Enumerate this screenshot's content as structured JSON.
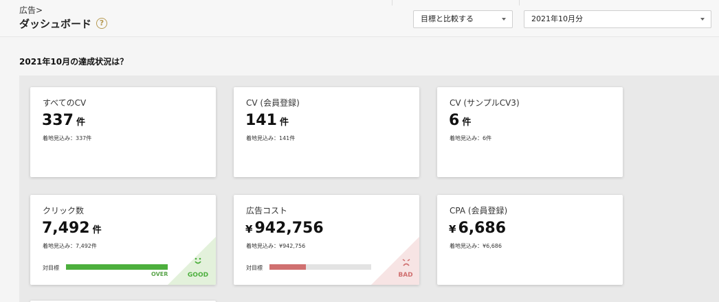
{
  "header": {
    "breadcrumb": "広告>",
    "title": "ダッシュボード",
    "help_icon": "question-circle-icon",
    "compare_select": "目標と比較する",
    "month_select": "2021年10月分"
  },
  "section": {
    "title": "2021年10月の達成状況は？"
  },
  "colors": {
    "good": "#4caf3d",
    "good_corner": "#e3f1db",
    "bad": "#d07070",
    "bad_corner": "#f7e4e4",
    "help": "#b79a52"
  },
  "cards": [
    {
      "label": "すべてのCV",
      "value": "337",
      "unit": "件",
      "forecast": "着地見込み：337件"
    },
    {
      "label": "CV (会員登録)",
      "value": "141",
      "unit": "件",
      "forecast": "着地見込み：141件"
    },
    {
      "label": "CV (サンプルCV3)",
      "value": "6",
      "unit": "件",
      "forecast": "着地見込み：6件"
    },
    {
      "label": "クリック数",
      "value": "7,492",
      "unit": "件",
      "forecast": "着地見込み：7,492件",
      "target_label": "対目標",
      "progress": 1.0,
      "progress_text": "OVER",
      "verdict": "GOOD",
      "face": "ᵕ"
    },
    {
      "label": "広告コスト",
      "currency": "¥",
      "value": "942,756",
      "forecast": "着地見込み：¥942,756",
      "target_label": "対目標",
      "progress": 0.36,
      "verdict": "BAD",
      "face": "☹"
    },
    {
      "label": "CPA (会員登録)",
      "currency": "¥",
      "value": "6,686",
      "forecast": "着地見込み：¥6,686"
    }
  ]
}
